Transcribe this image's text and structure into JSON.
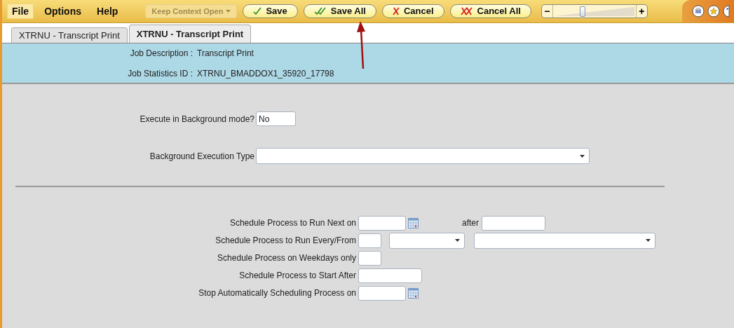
{
  "menu": [
    {
      "label": "File",
      "selected": true
    },
    {
      "label": "Options",
      "selected": false
    },
    {
      "label": "Help",
      "selected": false
    }
  ],
  "context_button": {
    "label": "Keep Context Open",
    "disabled": true
  },
  "actions": [
    {
      "label": "Save",
      "kind": "check"
    },
    {
      "label": "Save All",
      "kind": "double-check"
    },
    {
      "label": "Cancel",
      "kind": "cross"
    },
    {
      "label": "Cancel All",
      "kind": "double-cross"
    }
  ],
  "zoom": {
    "minus": "−",
    "plus": "+",
    "level": 0.35
  },
  "tabs": [
    {
      "label": "XTRNU - Transcript Print",
      "selected": false
    },
    {
      "label": "XTRNU - Transcript Print",
      "selected": true
    }
  ],
  "header": [
    {
      "label": "Job Description :",
      "value": "Transcript Print"
    },
    {
      "label": "Job Statistics ID :",
      "value": "XTRNU_BMADDOX1_35920_17798"
    }
  ],
  "background": [
    {
      "label": "Execute in Background mode?",
      "kind": "text",
      "value": "No"
    },
    {
      "label": "Background Execution Type",
      "kind": "select"
    }
  ],
  "schedule": [
    {
      "label": "Schedule Process to Run Next on",
      "controls": [
        {
          "kind": "date"
        },
        {
          "kind": "label",
          "text": "after"
        },
        {
          "kind": "medium"
        }
      ]
    },
    {
      "label": "Schedule Process to Run Every/From",
      "controls": [
        {
          "kind": "short"
        },
        {
          "kind": "select-small"
        },
        {
          "kind": "select-wide"
        }
      ]
    },
    {
      "label": "Schedule Process on Weekdays only",
      "controls": [
        {
          "kind": "short"
        }
      ]
    },
    {
      "label": "Schedule Process to Start After",
      "controls": [
        {
          "kind": "medium"
        }
      ]
    },
    {
      "label": "Stop Automatically Scheduling Process on",
      "controls": [
        {
          "kind": "date"
        }
      ]
    }
  ]
}
